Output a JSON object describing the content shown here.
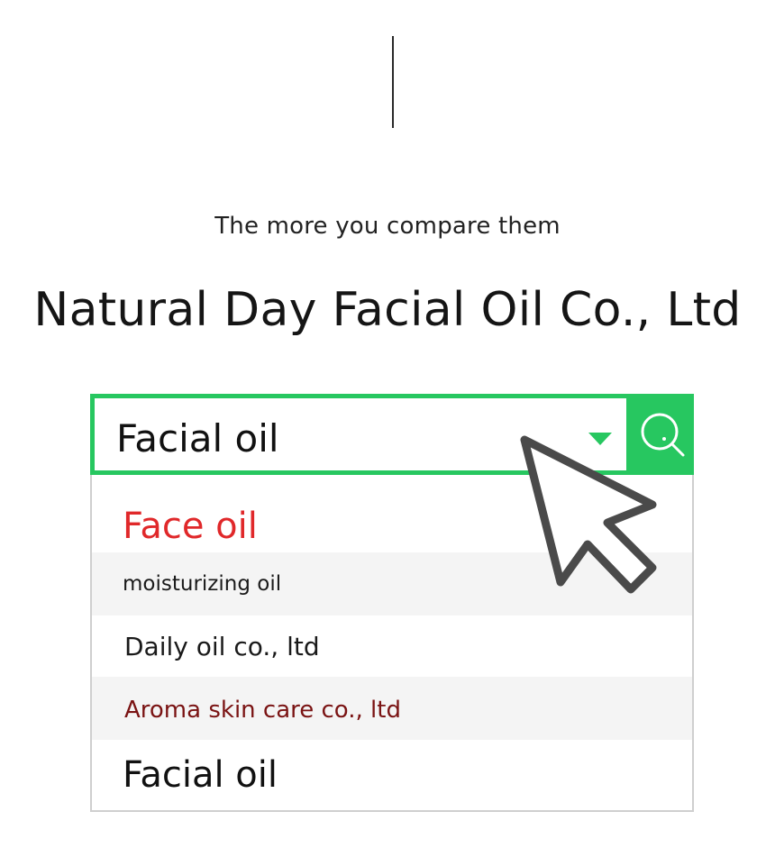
{
  "tagline": "The more you compare them",
  "headline": "Natural Day Facial Oil Co., Ltd",
  "search": {
    "value": "Facial oil",
    "button_icon": "search-icon",
    "dropdown_icon": "caret-down-icon"
  },
  "suggestions": [
    {
      "label": "Face oil"
    },
    {
      "label": "moisturizing oil"
    },
    {
      "label": "Daily oil co., ltd"
    },
    {
      "label": "Aroma skin care co., ltd"
    },
    {
      "label": "Facial oil"
    }
  ],
  "colors": {
    "accent": "#27c760",
    "highlight_text": "#e0282a",
    "secondary_text": "#7a1313"
  },
  "pointer_icon": "mouse-cursor-icon"
}
